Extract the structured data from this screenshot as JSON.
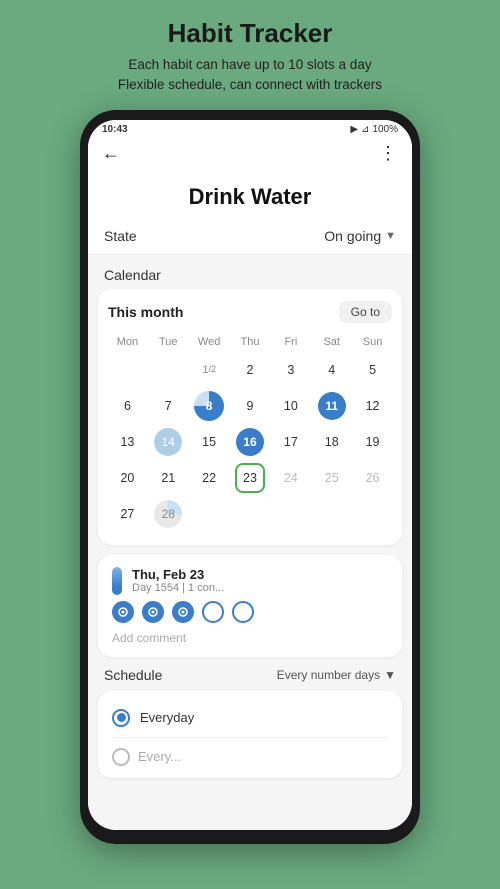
{
  "app": {
    "title": "Habit Tracker",
    "subtitle_line1": "Each habit can have up to 10 slots a day",
    "subtitle_line2": "Flexible schedule, can connect with trackers"
  },
  "status_bar": {
    "time": "10:43",
    "battery": "100%",
    "icons": "📶"
  },
  "screen": {
    "habit_name": "Drink Water",
    "state_label": "State",
    "state_value": "On going",
    "calendar_label": "Calendar",
    "calendar_month": "This month",
    "goto_btn": "Go to",
    "days_of_week": [
      "Mon",
      "Tue",
      "Wed",
      "Thu",
      "Fri",
      "Sat",
      "Sun"
    ],
    "calendar_rows": [
      [
        {
          "label": "1/2",
          "type": "normal"
        },
        {
          "label": "2",
          "type": "normal"
        },
        {
          "label": "3",
          "type": "normal"
        },
        {
          "label": "4",
          "type": "normal"
        },
        {
          "label": "5",
          "type": "normal"
        }
      ],
      [
        {
          "label": "6",
          "type": "normal"
        },
        {
          "label": "7",
          "type": "normal"
        },
        {
          "label": "8",
          "type": "pie"
        },
        {
          "label": "9",
          "type": "normal"
        },
        {
          "label": "10",
          "type": "normal"
        },
        {
          "label": "11",
          "type": "filled-dark"
        },
        {
          "label": "12",
          "type": "normal"
        }
      ],
      [
        {
          "label": "13",
          "type": "normal"
        },
        {
          "label": "14",
          "type": "filled-light"
        },
        {
          "label": "15",
          "type": "normal"
        },
        {
          "label": "16",
          "type": "filled-dark"
        },
        {
          "label": "17",
          "type": "normal"
        },
        {
          "label": "18",
          "type": "normal"
        },
        {
          "label": "19",
          "type": "normal"
        }
      ],
      [
        {
          "label": "20",
          "type": "normal"
        },
        {
          "label": "21",
          "type": "normal"
        },
        {
          "label": "22",
          "type": "normal"
        },
        {
          "label": "23",
          "type": "today"
        },
        {
          "label": "24",
          "type": "muted"
        },
        {
          "label": "25",
          "type": "muted"
        },
        {
          "label": "26",
          "type": "muted"
        }
      ],
      [
        {
          "label": "27",
          "type": "normal"
        },
        {
          "label": "28",
          "type": "pie28"
        }
      ]
    ],
    "day_detail": {
      "date": "Thu, Feb 23",
      "sub": "Day 1554 | 1 con...",
      "slots": [
        {
          "filled": true
        },
        {
          "filled": true
        },
        {
          "filled": true
        },
        {
          "filled": false
        },
        {
          "filled": false
        }
      ],
      "add_comment": "Add comment"
    },
    "schedule_label": "Schedule",
    "schedule_dropdown": "Every number days",
    "schedule_options": [
      {
        "label": "Everyday",
        "selected": true
      },
      {
        "label": "Every...",
        "selected": false
      }
    ]
  }
}
